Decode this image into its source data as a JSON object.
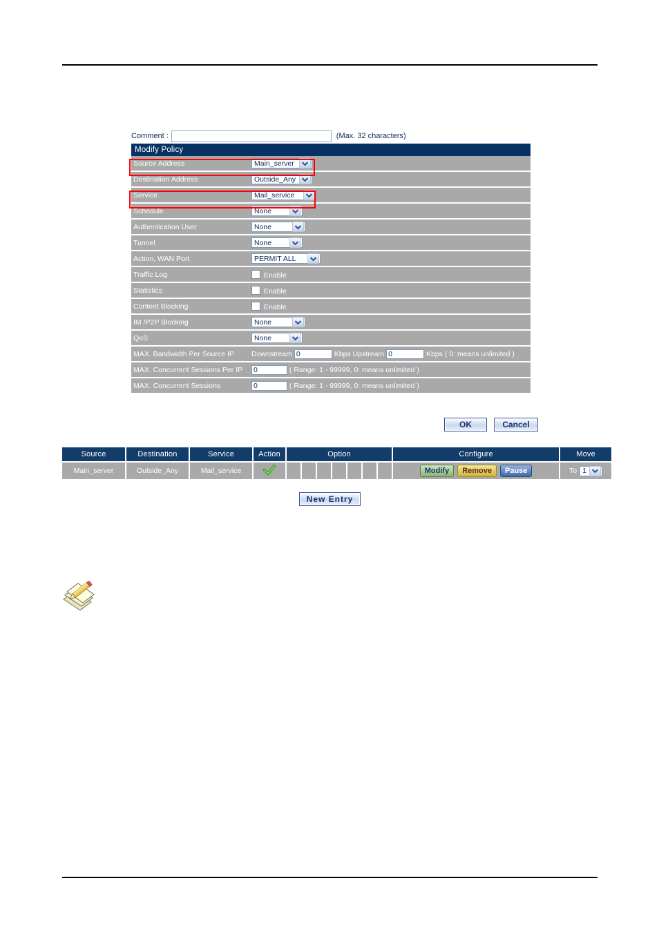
{
  "form": {
    "comment_label": "Comment :",
    "comment_value": "",
    "comment_placeholder": "",
    "comment_hint": "(Max. 32 characters)",
    "title": "Modify Policy",
    "rows": [
      {
        "label": "Source Address",
        "control": "select",
        "value": "Main_server"
      },
      {
        "label": "Destination Address",
        "control": "select",
        "value": "Outside_Any"
      },
      {
        "label": "Service",
        "control": "select",
        "value": "Mail_service"
      },
      {
        "label": "Schedule",
        "control": "select",
        "value": "None"
      },
      {
        "label": "Authentication User",
        "control": "select",
        "value": "None"
      },
      {
        "label": "Tunnel",
        "control": "select",
        "value": "None"
      },
      {
        "label": "Action, WAN Port",
        "control": "select",
        "value": "PERMIT ALL"
      },
      {
        "label": "Traffic Log",
        "control": "checkbox",
        "value": "Enable",
        "checked": false
      },
      {
        "label": "Statistics",
        "control": "checkbox",
        "value": "Enable",
        "checked": false
      },
      {
        "label": "Content Blocking",
        "control": "checkbox",
        "value": "Enable",
        "checked": false
      },
      {
        "label": "IM /P2P Blocking",
        "control": "select",
        "value": "None"
      },
      {
        "label": "QoS",
        "control": "select",
        "value": "None"
      },
      {
        "label": "MAX. Bandwidth Per Source IP",
        "control": "bandwidth"
      },
      {
        "label": "MAX. Concurrent Sessions Per IP",
        "control": "number",
        "value": "0",
        "note": "( Range: 1 - 99999, 0: means unlimited )"
      },
      {
        "label": "MAX. Concurrent Sessions",
        "control": "number",
        "value": "0",
        "note": "( Range: 1 - 99999, 0: means unlimited )"
      }
    ],
    "bandwidth": {
      "downstream_label": "Downstream",
      "downstream_value": "0",
      "kbps_label_1": "Kbps",
      "upstream_label": "Upstream",
      "upstream_value": "0",
      "kbps_label_2": "Kbps",
      "note": "( 0: means unlimited )"
    },
    "ok_label": "OK",
    "cancel_label": "Cancel"
  },
  "policy_list": {
    "headers": [
      "Source",
      "Destination",
      "Service",
      "Action",
      "Option",
      "Configure",
      "Move"
    ],
    "rows": [
      {
        "source": "Main_server",
        "destination": "Outside_Any",
        "service": "Mail_service",
        "action": "permitted",
        "option_cells": [
          "",
          "",
          "",
          "",
          "",
          "",
          ""
        ],
        "configure": {
          "modify": "Modify",
          "remove": "Remove",
          "pause": "Pause"
        },
        "move": {
          "to_label": "To",
          "value": "1"
        }
      }
    ],
    "new_entry_label": "New Entry"
  },
  "colors": {
    "header_navy": "#073163",
    "table_header_navy": "#123C69",
    "row_gray": "#a9a9a9",
    "highlight_red": "#FF0000",
    "accent_text": "#102A5C",
    "check_green": "#44C03A"
  }
}
